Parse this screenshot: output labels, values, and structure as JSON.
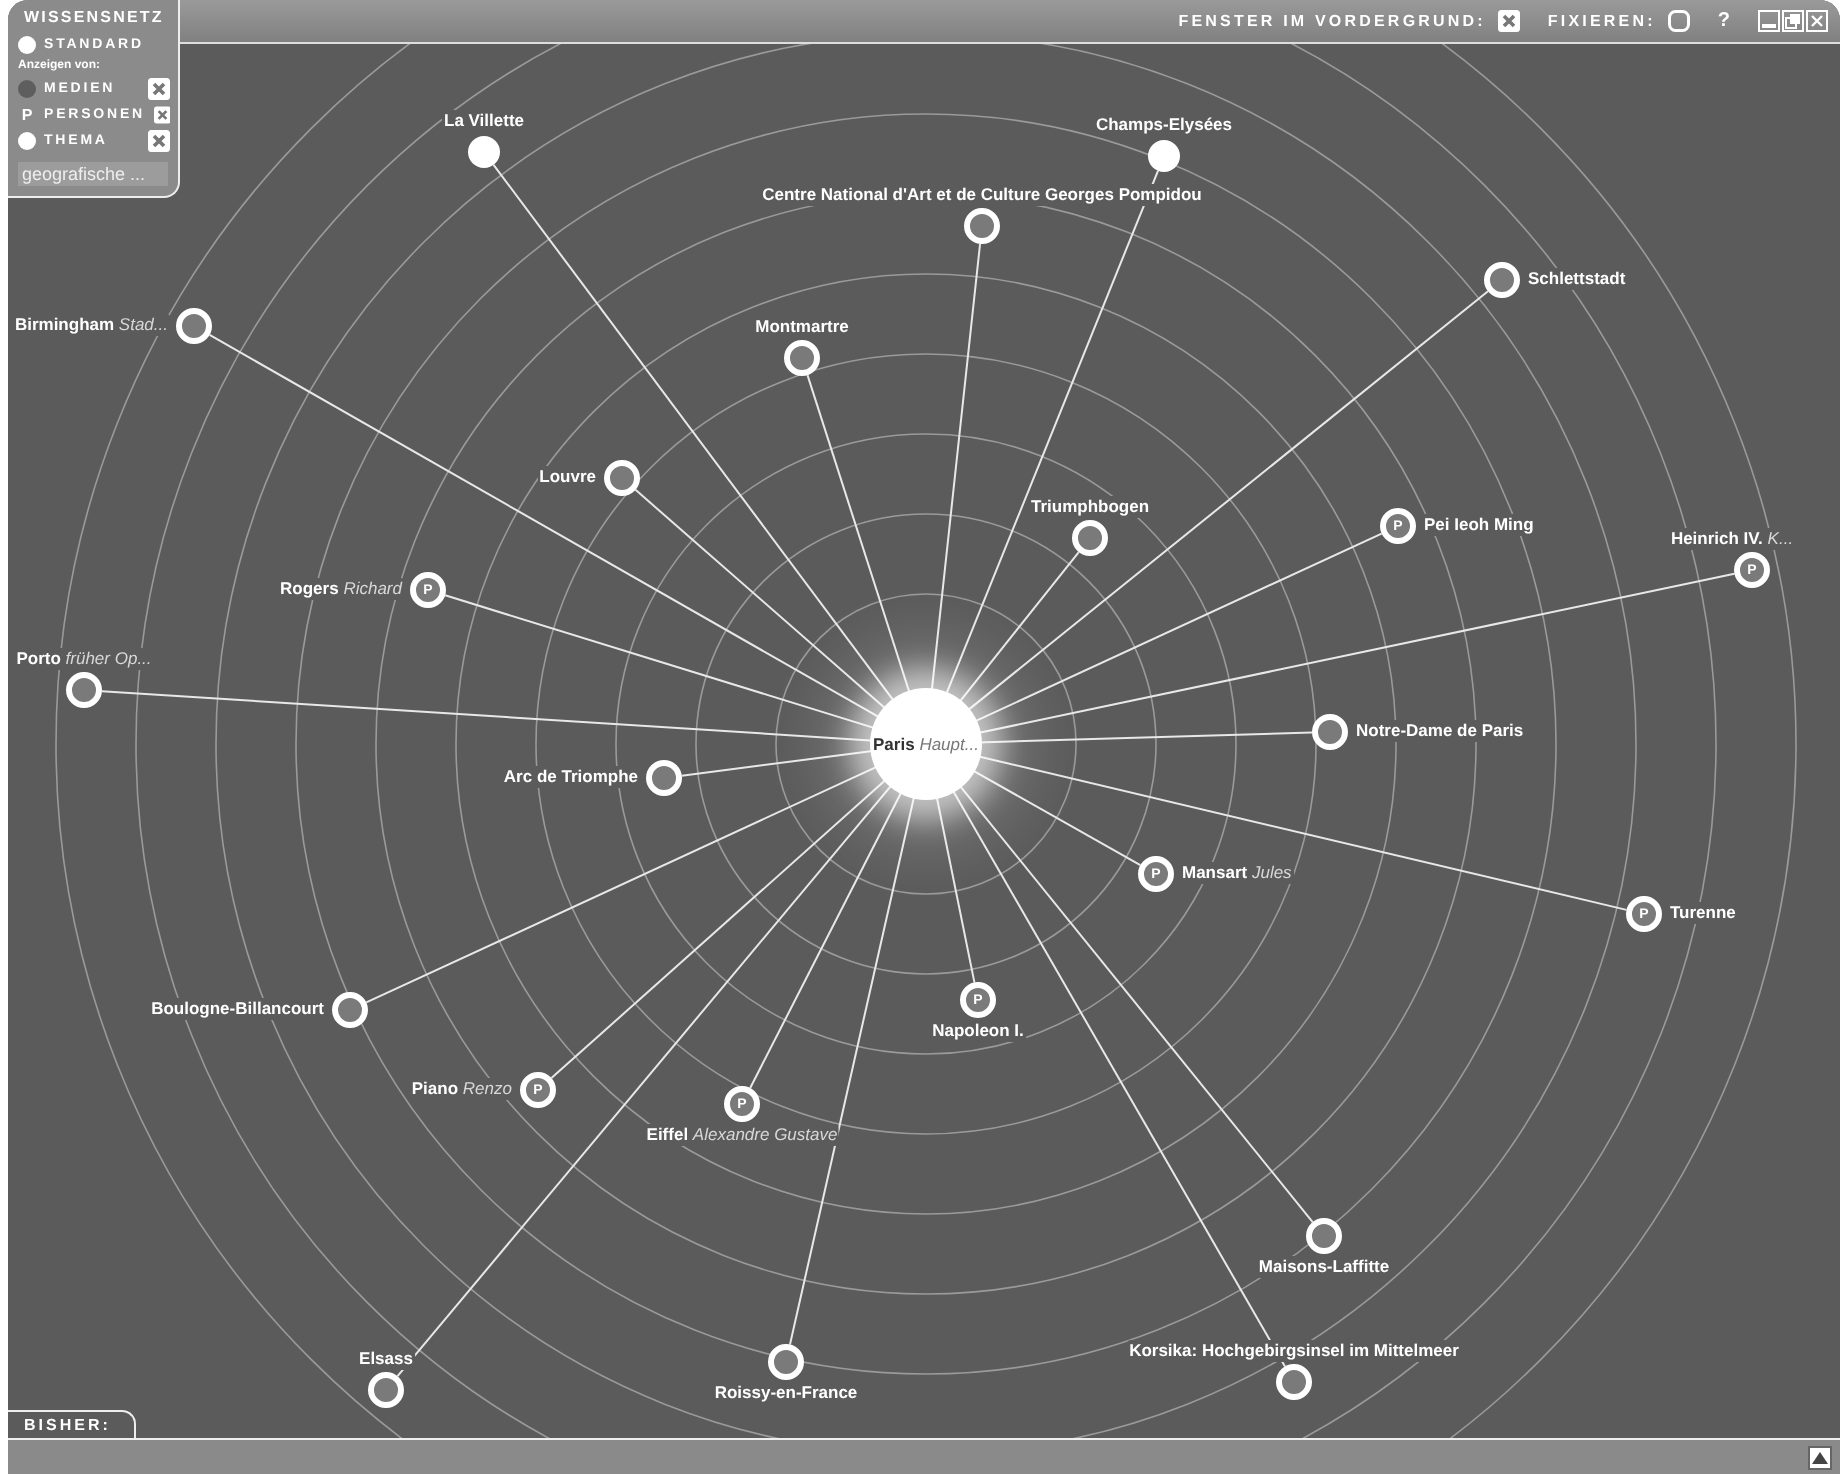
{
  "window": {
    "title": "WISSENSNETZ",
    "foreground_label": "FENSTER IM VORDERGRUND:",
    "foreground": true,
    "pin_label": "FIXIEREN:",
    "pinned": false,
    "help": "?"
  },
  "legend": {
    "standard": "STANDARD",
    "show_label": "Anzeigen von:",
    "filters": [
      {
        "kind": "media",
        "label": "MEDIEN",
        "checked": true
      },
      {
        "kind": "person",
        "label": "PERSONEN",
        "symbol": "P",
        "checked": true
      },
      {
        "kind": "topic",
        "label": "THEMA",
        "checked": true
      }
    ],
    "search": {
      "placeholder": "geografische ..."
    }
  },
  "center": {
    "name": "Paris",
    "detail": "Haupt..."
  },
  "nodes": [
    {
      "kind": "topic",
      "name": "La Villette"
    },
    {
      "kind": "topic",
      "name": "Champs-Elysées"
    },
    {
      "kind": "place",
      "name": "Centre National d'Art et de Culture Georges Pompidou"
    },
    {
      "kind": "place",
      "name": "Schlettstadt"
    },
    {
      "kind": "place",
      "name": "Birmingham",
      "detail": "Stad..."
    },
    {
      "kind": "place",
      "name": "Montmartre"
    },
    {
      "kind": "place",
      "name": "Louvre"
    },
    {
      "kind": "place",
      "name": "Triumphbogen"
    },
    {
      "kind": "person",
      "name": "Pei Ieoh Ming",
      "badge": "P"
    },
    {
      "kind": "person",
      "name": "Heinrich IV.",
      "detail": "K...",
      "badge": "P"
    },
    {
      "kind": "person",
      "name": "Rogers",
      "detail": "Richard",
      "badge": "P"
    },
    {
      "kind": "place",
      "name": "Porto",
      "detail": "früher Op..."
    },
    {
      "kind": "place",
      "name": "Notre-Dame de Paris"
    },
    {
      "kind": "place",
      "name": "Arc de Triomphe"
    },
    {
      "kind": "person",
      "name": "Mansart",
      "detail": "Jules",
      "badge": "P"
    },
    {
      "kind": "person",
      "name": "Turenne",
      "badge": "P"
    },
    {
      "kind": "place",
      "name": "Boulogne-Billancourt"
    },
    {
      "kind": "person",
      "name": "Napoleon I.",
      "badge": "P"
    },
    {
      "kind": "person",
      "name": "Piano",
      "detail": "Renzo",
      "badge": "P"
    },
    {
      "kind": "person",
      "name": "Eiffel",
      "detail": "Alexandre Gustave",
      "badge": "P"
    },
    {
      "kind": "place",
      "name": "Maisons-Laffitte"
    },
    {
      "kind": "place",
      "name": "Elsass"
    },
    {
      "kind": "place",
      "name": "Roissy-en-France"
    },
    {
      "kind": "place",
      "name": "Korsika: Hochgebirgsinsel im Mittelmeer"
    }
  ],
  "history": {
    "label": "BISHER:"
  }
}
